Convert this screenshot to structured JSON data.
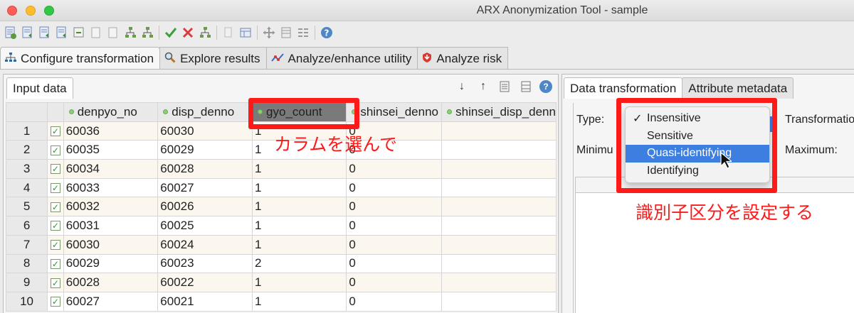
{
  "window": {
    "title": "ARX Anonymization Tool - sample"
  },
  "toolbar": {
    "icons": [
      "new-project-icon",
      "open-project-icon",
      "save-project-icon",
      "save-as-icon",
      "import-data-icon",
      "export-data-icon",
      "import-hierarchy-icon",
      "export-hierarchy-icon",
      "create-hierarchy-icon",
      "anonymize-icon",
      "reset-icon",
      "clear-icon",
      "settings-icon",
      "preferences-icon",
      "transform-icon",
      "list-view-icon",
      "grid-view-icon",
      "help-icon"
    ]
  },
  "main_tabs": [
    {
      "label": "Configure transformation",
      "icon": "hierarchy-icon",
      "active": true
    },
    {
      "label": "Explore results",
      "icon": "magnifier-icon"
    },
    {
      "label": "Analyze/enhance utility",
      "icon": "chart-icon"
    },
    {
      "label": "Analyze risk",
      "icon": "risk-icon"
    }
  ],
  "input_panel": {
    "tab_label": "Input data",
    "columns": [
      "denpyo_no",
      "disp_denno",
      "gyo_count",
      "shinsei_denno",
      "shinsei_disp_denn"
    ],
    "rows": [
      {
        "n": "1",
        "denpyo_no": "60036",
        "disp_denno": "60030",
        "gyo_count": "1",
        "shinsei_denno": "0"
      },
      {
        "n": "2",
        "denpyo_no": "60035",
        "disp_denno": "60029",
        "gyo_count": "1",
        "shinsei_denno": "0"
      },
      {
        "n": "3",
        "denpyo_no": "60034",
        "disp_denno": "60028",
        "gyo_count": "1",
        "shinsei_denno": "0"
      },
      {
        "n": "4",
        "denpyo_no": "60033",
        "disp_denno": "60027",
        "gyo_count": "1",
        "shinsei_denno": "0"
      },
      {
        "n": "5",
        "denpyo_no": "60032",
        "disp_denno": "60026",
        "gyo_count": "1",
        "shinsei_denno": "0"
      },
      {
        "n": "6",
        "denpyo_no": "60031",
        "disp_denno": "60025",
        "gyo_count": "1",
        "shinsei_denno": "0"
      },
      {
        "n": "7",
        "denpyo_no": "60030",
        "disp_denno": "60024",
        "gyo_count": "1",
        "shinsei_denno": "0"
      },
      {
        "n": "8",
        "denpyo_no": "60029",
        "disp_denno": "60023",
        "gyo_count": "2",
        "shinsei_denno": "0"
      },
      {
        "n": "9",
        "denpyo_no": "60028",
        "disp_denno": "60022",
        "gyo_count": "1",
        "shinsei_denno": "0"
      },
      {
        "n": "10",
        "denpyo_no": "60027",
        "disp_denno": "60021",
        "gyo_count": "1",
        "shinsei_denno": "0"
      }
    ]
  },
  "right_panel": {
    "tabs": [
      "Data transformation",
      "Attribute metadata"
    ],
    "type_label": "Type:",
    "transformation_label": "Transformatio",
    "minimum_label": "Minimu",
    "maximum_label": "Maximum:",
    "type_options": [
      "Insensitive",
      "Sensitive",
      "Quasi-identifying",
      "Identifying"
    ],
    "type_selected": "Insensitive",
    "type_highlighted": "Quasi-identifying"
  },
  "annotations": {
    "select_column": "カラムを選んで",
    "set_identifier": "識別子区分を設定する",
    "color": "#ff1a1a"
  }
}
